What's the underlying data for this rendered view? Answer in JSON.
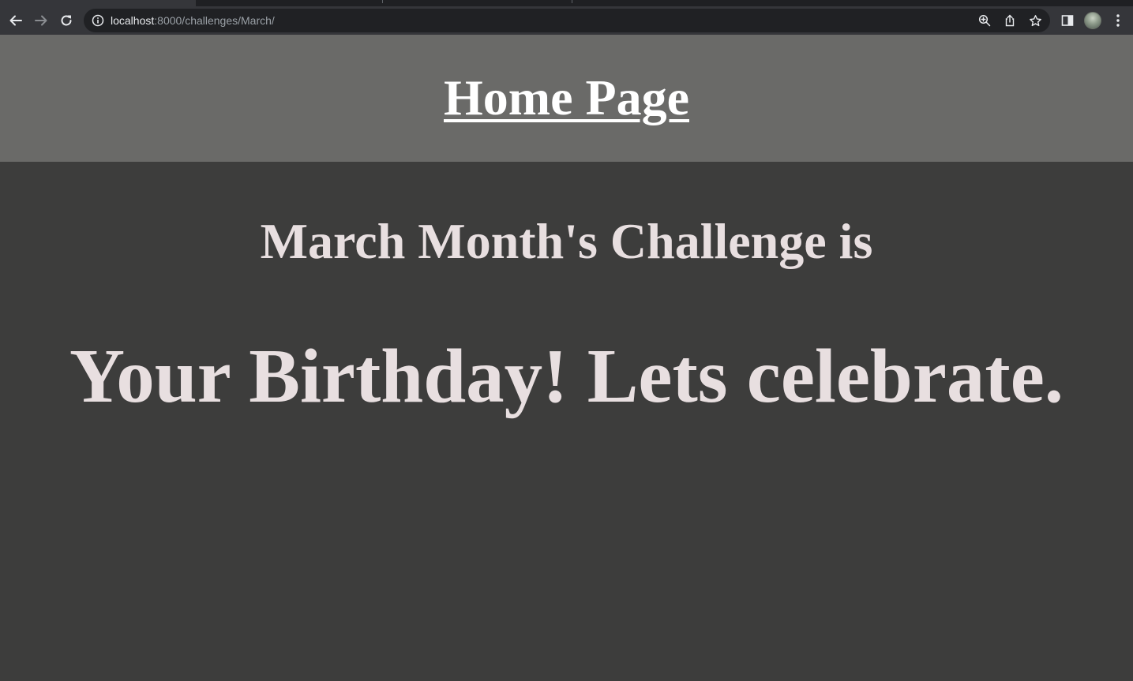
{
  "browser": {
    "url_host": "localhost",
    "url_path": ":8000/challenges/March/",
    "icons": {
      "back": "arrow-left-icon",
      "forward": "arrow-right-icon",
      "reload": "reload-icon",
      "site_info": "info-icon",
      "zoom": "zoom-icon",
      "share": "share-icon",
      "bookmark": "star-icon",
      "side_panel": "side-panel-icon",
      "profile": "avatar",
      "menu": "kebab-menu-icon"
    }
  },
  "page": {
    "home_link": "Home Page",
    "heading": "March Month's Challenge is",
    "challenge": "Your Birthday! Lets celebrate."
  },
  "colors": {
    "page_background": "#3d3d3c",
    "header_background": "#6a6a68",
    "link_color": "#ffffff",
    "text_color": "#e8dfe0"
  }
}
